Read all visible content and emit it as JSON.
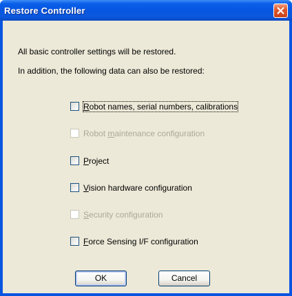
{
  "window": {
    "title": "Restore Controller"
  },
  "message": {
    "line1": "All basic controller settings will be restored.",
    "line2": "In addition, the following data can also be restored:"
  },
  "options": [
    {
      "pre": "",
      "mnemonic": "R",
      "post": "obot names, serial numbers, calibrations",
      "enabled": true,
      "checked": false
    },
    {
      "pre": "Robot ",
      "mnemonic": "m",
      "post": "aintenance configuration",
      "enabled": false,
      "checked": false
    },
    {
      "pre": "",
      "mnemonic": "P",
      "post": "roject",
      "enabled": true,
      "checked": false
    },
    {
      "pre": "",
      "mnemonic": "V",
      "post": "ision hardware configuration",
      "enabled": true,
      "checked": false
    },
    {
      "pre": "",
      "mnemonic": "S",
      "post": "ecurity configuration",
      "enabled": false,
      "checked": false
    },
    {
      "pre": "",
      "mnemonic": "F",
      "post": "orce Sensing I/F configuration",
      "enabled": true,
      "checked": false
    }
  ],
  "buttons": {
    "ok": "OK",
    "cancel": "Cancel"
  },
  "icons": {
    "close": "close-icon"
  },
  "colors": {
    "title_bar": "#0556e1",
    "dialog_face": "#ece9d8",
    "close_button": "#e0582c",
    "disabled_text": "#aca899"
  }
}
